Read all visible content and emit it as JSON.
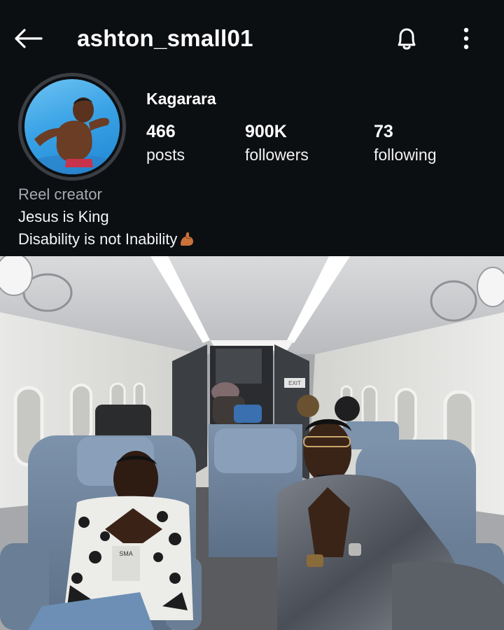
{
  "header": {
    "username": "ashton_small01",
    "back_icon": "arrow-left-icon",
    "notify_icon": "bell-icon",
    "more_icon": "more-vertical-icon"
  },
  "profile": {
    "display_name": "Kagarara",
    "stats": [
      {
        "value": "466",
        "label": "posts"
      },
      {
        "value": "900K",
        "label": "followers"
      },
      {
        "value": "73",
        "label": "following"
      }
    ],
    "bio": {
      "category": "Reel creator",
      "line1": "Jesus is King",
      "line2": "Disability is not Inability",
      "line2_emoji": "flexed-biceps-icon"
    }
  },
  "photo": {
    "exit_sign": "EXIT",
    "shirt_text": "SMA"
  },
  "colors": {
    "background": "#0c0f12",
    "text_primary": "#ffffff",
    "text_secondary": "#a7aab0",
    "avatar_ring": "#3a3d42"
  }
}
